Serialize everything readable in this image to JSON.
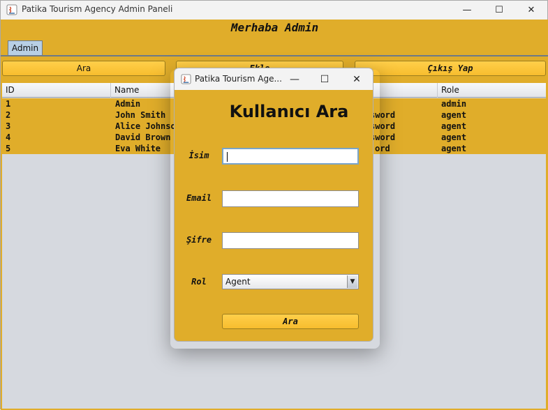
{
  "window": {
    "title": "Patika Tourism Agency Admin Paneli",
    "minimize": "—",
    "maximize": "☐",
    "close": "✕"
  },
  "header": {
    "welcome": "Merhaba Admin"
  },
  "tabs": [
    {
      "label": "Admin"
    }
  ],
  "toolbar": {
    "search_label": "Ara",
    "add_label": "Ekle",
    "logout_label": "Çıkış Yap"
  },
  "table": {
    "columns": [
      "ID",
      "Name",
      "",
      "Role"
    ],
    "rows": [
      {
        "id": "1",
        "name": "Admin",
        "password": "",
        "role": "admin"
      },
      {
        "id": "2",
        "name": "John Smith",
        "password": "sword",
        "role": "agent"
      },
      {
        "id": "3",
        "name": "Alice Johnson",
        "password": "sword",
        "role": "agent"
      },
      {
        "id": "4",
        "name": "David Brown",
        "password": "sword",
        "role": "agent"
      },
      {
        "id": "5",
        "name": "Eva White",
        "password": "ord",
        "role": "agent"
      }
    ]
  },
  "dialog": {
    "title": "Patika Tourism Age...",
    "minimize": "—",
    "maximize": "☐",
    "close": "✕",
    "heading": "Kullanıcı Ara",
    "name_label": "İsim",
    "name_value": "",
    "email_label": "Email",
    "email_value": "",
    "password_label": "Şifre",
    "password_value": "",
    "role_label": "Rol",
    "role_selected": "Agent",
    "search_button": "Ara"
  },
  "colors": {
    "accent": "#e0ad2a",
    "button": "#f7bd2e",
    "tab": "#b8cfe5",
    "table_bg": "#d6d9df"
  }
}
